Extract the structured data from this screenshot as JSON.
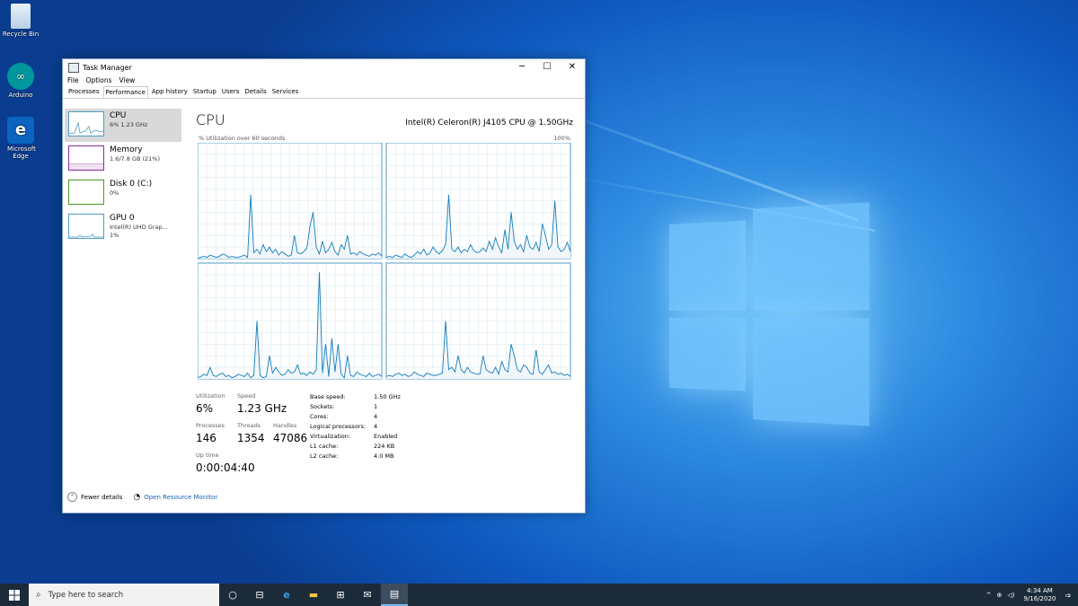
{
  "desktop": {
    "icons": [
      {
        "label": "Recycle Bin",
        "icon": "recycle-bin-icon"
      },
      {
        "label": "Arduino",
        "icon": "arduino-icon"
      },
      {
        "label": "Microsoft Edge",
        "icon": "edge-icon"
      }
    ]
  },
  "window": {
    "title": "Task Manager",
    "controls": {
      "minimize": "─",
      "maximize": "☐",
      "close": "✕"
    },
    "menu": [
      "File",
      "Options",
      "View"
    ],
    "tabs": [
      "Processes",
      "Performance",
      "App history",
      "Startup",
      "Users",
      "Details",
      "Services"
    ],
    "active_tab": "Performance"
  },
  "sidebar": [
    {
      "name": "CPU",
      "detail": "6% 1.23 GHz",
      "color": "#4f9bc4"
    },
    {
      "name": "Memory",
      "detail": "1.6/7.8 GB (21%)",
      "color": "#8b2d9e"
    },
    {
      "name": "Disk 0 (C:)",
      "detail": "0%",
      "color": "#4d9a1f"
    },
    {
      "name": "GPU 0",
      "detail": "Intel(R) UHD Grap...",
      "detail2": "1%",
      "color": "#4f9bc4"
    }
  ],
  "cpu": {
    "title": "CPU",
    "model": "Intel(R) Celeron(R) J4105 CPU @ 1.50GHz",
    "util_label": "% Utilization over 60 seconds",
    "util_max": "100%",
    "graphs": [
      {
        "values": [
          0,
          1,
          2,
          1,
          3,
          2,
          1,
          2,
          4,
          3,
          1,
          2,
          1,
          1,
          2,
          3,
          1,
          55,
          5,
          8,
          4,
          12,
          6,
          10,
          5,
          8,
          3,
          6,
          4,
          2,
          3,
          20,
          5,
          4,
          6,
          9,
          28,
          40,
          10,
          4,
          15,
          5,
          8,
          14,
          6,
          3,
          12,
          8,
          20,
          4,
          5,
          3,
          6,
          4,
          3,
          2,
          4,
          3,
          5,
          2
        ]
      },
      {
        "values": [
          1,
          2,
          1,
          3,
          2,
          1,
          4,
          2,
          1,
          3,
          6,
          4,
          8,
          3,
          5,
          10,
          6,
          4,
          7,
          12,
          55,
          8,
          6,
          10,
          5,
          8,
          6,
          12,
          7,
          5,
          6,
          9,
          6,
          15,
          8,
          18,
          10,
          5,
          25,
          8,
          40,
          15,
          8,
          12,
          6,
          20,
          10,
          8,
          14,
          6,
          30,
          20,
          8,
          12,
          50,
          10,
          6,
          8,
          14,
          6
        ]
      },
      {
        "values": [
          1,
          2,
          4,
          3,
          10,
          3,
          2,
          4,
          5,
          2,
          3,
          1,
          2,
          4,
          3,
          2,
          5,
          1,
          3,
          50,
          3,
          1,
          2,
          20,
          5,
          10,
          6,
          3,
          4,
          8,
          5,
          6,
          12,
          4,
          5,
          3,
          6,
          4,
          8,
          92,
          5,
          30,
          2,
          35,
          6,
          30,
          4,
          1,
          20,
          3,
          2,
          6,
          4,
          3,
          2,
          5,
          2,
          3,
          4,
          2
        ]
      },
      {
        "values": [
          2,
          3,
          2,
          4,
          5,
          3,
          4,
          2,
          3,
          6,
          4,
          3,
          2,
          5,
          4,
          3,
          3,
          4,
          5,
          50,
          8,
          10,
          6,
          20,
          8,
          5,
          10,
          6,
          5,
          4,
          4,
          20,
          8,
          6,
          5,
          10,
          4,
          15,
          8,
          6,
          30,
          20,
          8,
          6,
          12,
          10,
          5,
          4,
          25,
          6,
          4,
          8,
          12,
          5,
          6,
          4,
          5,
          3,
          4,
          2
        ]
      }
    ]
  },
  "stats": {
    "utilization_label": "Utilization",
    "utilization": "6%",
    "speed_label": "Speed",
    "speed": "1.23 GHz",
    "processes_label": "Processes",
    "processes": "146",
    "threads_label": "Threads",
    "threads": "1354",
    "handles_label": "Handles",
    "handles": "47086",
    "uptime_label": "Up time",
    "uptime": "0:00:04:40"
  },
  "specs": [
    {
      "label": "Base speed:",
      "value": "1.50 GHz"
    },
    {
      "label": "Sockets:",
      "value": "1"
    },
    {
      "label": "Cores:",
      "value": "4"
    },
    {
      "label": "Logical processors:",
      "value": "4"
    },
    {
      "label": "Virtualization:",
      "value": "Enabled"
    },
    {
      "label": "L1 cache:",
      "value": "224 KB"
    },
    {
      "label": "L2 cache:",
      "value": "4.0 MB"
    }
  ],
  "footer": {
    "fewer_details": "Fewer details",
    "resource_monitor": "Open Resource Monitor"
  },
  "taskbar": {
    "search_placeholder": "Type here to search",
    "time": "4:34 AM",
    "date": "9/16/2020",
    "notification_count": "1"
  }
}
